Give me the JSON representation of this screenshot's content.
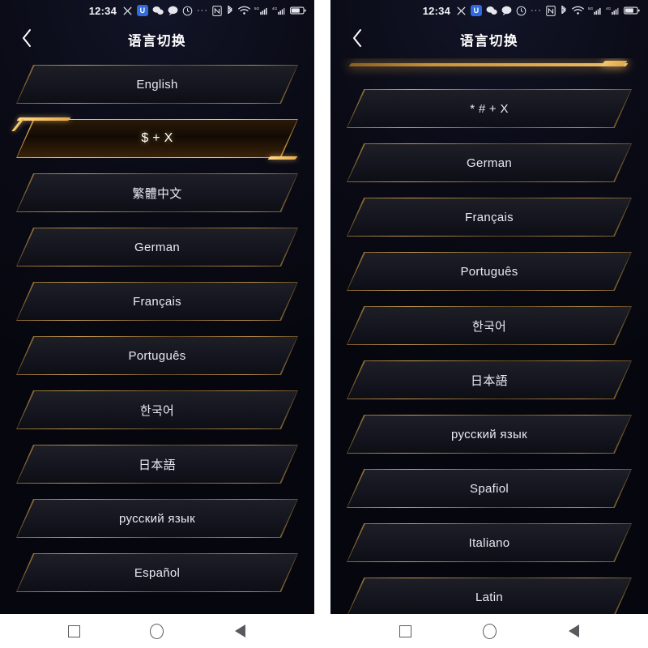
{
  "statusbar": {
    "time": "12:34",
    "icons": [
      "silent-mode-icon",
      "shield-badge-icon",
      "wechat-icon",
      "message-bubble-icon",
      "alarm-icon",
      "more-dots-icon",
      "nfc-icon",
      "bluetooth-icon",
      "wifi-icon",
      "signal-5g-icon",
      "signal-4g-icon",
      "battery-icon"
    ],
    "dots": "···",
    "badge_label": "U",
    "signal1_label": "5G",
    "signal2_label": "4G"
  },
  "header": {
    "title": "语言切换",
    "back_icon": "back-chevron-icon"
  },
  "navbar": {
    "recents_label": "recents-square-icon",
    "home_label": "home-circle-icon",
    "back_label": "back-triangle-icon"
  },
  "colors": {
    "accent_gold": "#e0a94f",
    "accent_gold_bright": "#f3c877",
    "background": "#07080f",
    "button_fill": "#15161f",
    "text": "#e8eaf0"
  },
  "left_panel": {
    "scrolled": false,
    "items": [
      {
        "label": "English",
        "selected": false
      },
      {
        "label": "$ + X",
        "selected": true
      },
      {
        "label": "繁體中文",
        "selected": false
      },
      {
        "label": "German",
        "selected": false
      },
      {
        "label": "Français",
        "selected": false
      },
      {
        "label": "Português",
        "selected": false
      },
      {
        "label": "한국어",
        "selected": false
      },
      {
        "label": "日本語",
        "selected": false
      },
      {
        "label": "русский язык",
        "selected": false
      },
      {
        "label": "Español",
        "selected": false
      }
    ]
  },
  "right_panel": {
    "scrolled": true,
    "partial_top_item": "selected-item-scrolled-offscreen",
    "items": [
      {
        "label": "* # + X",
        "selected": false
      },
      {
        "label": "German",
        "selected": false
      },
      {
        "label": "Français",
        "selected": false
      },
      {
        "label": "Português",
        "selected": false
      },
      {
        "label": "한국어",
        "selected": false
      },
      {
        "label": "日本語",
        "selected": false
      },
      {
        "label": "русский язык",
        "selected": false
      },
      {
        "label": "Spafiol",
        "selected": false
      },
      {
        "label": "Italiano",
        "selected": false
      },
      {
        "label": "Latin",
        "selected": false
      }
    ]
  }
}
